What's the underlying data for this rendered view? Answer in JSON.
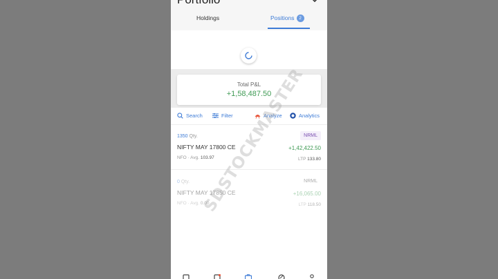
{
  "header": {
    "title": "Portfolio"
  },
  "tabs": [
    {
      "label": "Holdings"
    },
    {
      "label": "Positions",
      "badge": "2",
      "active": true
    }
  ],
  "summary": {
    "label": "Total P&L",
    "value": "+1,58,487.50"
  },
  "toolbar": {
    "search": "Search",
    "filter": "Filter",
    "analyze": "Analyze",
    "analytics": "Analytics"
  },
  "positions": [
    {
      "qty": "1350",
      "qty_unit": "Qty.",
      "symbol": "NIFTY MAY 17800 CE",
      "exchange": "NFO",
      "avg_label": "Avg.",
      "avg": "103.97",
      "product": "NRML",
      "pnl": "+1,42,422.50",
      "ltp_label": "LTP",
      "ltp": "133.80"
    },
    {
      "qty": "0",
      "qty_unit": "Qty.",
      "symbol": "NIFTY MAY 17850 CE",
      "exchange": "NFO",
      "avg_label": "Avg.",
      "avg": "0.00",
      "product": "NRML",
      "pnl": "+16,065.00",
      "ltp_label": "LTP",
      "ltp": "118.50"
    }
  ],
  "watermark": "SDSTOCKMASTER",
  "colors": {
    "accent": "#3d7bd6",
    "profit": "#3f9a54",
    "product": "#7a4fb0"
  },
  "icons": {
    "chevron": "chevron-down-icon",
    "search": "search-icon",
    "filter": "filter-icon",
    "analyze": "analyze-icon",
    "analytics": "analytics-icon",
    "spinner": "loading-spinner-icon"
  }
}
